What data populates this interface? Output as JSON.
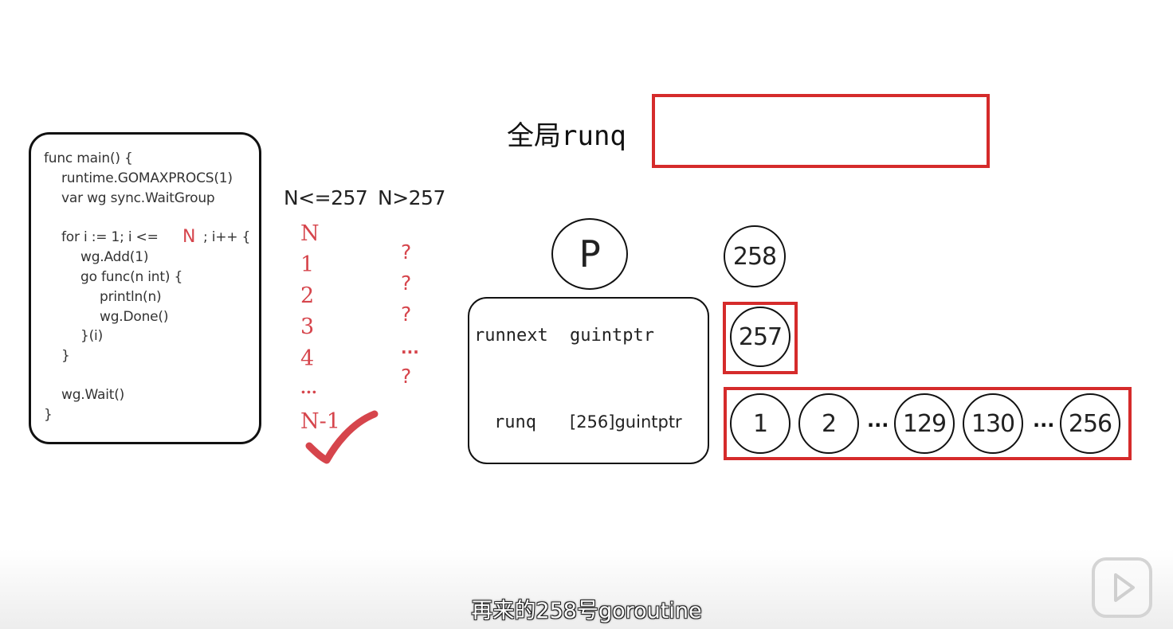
{
  "code": {
    "lines": [
      "func main() {",
      "runtime.GOMAXPROCS(1)",
      "var wg sync.WaitGroup",
      "for i := 1; i <=",
      "N",
      "; i++ {",
      "wg.Add(1)",
      "go func(n int) {",
      "println(n)",
      "wg.Done()",
      "}(i)",
      "}",
      "wg.Wait()",
      "}"
    ]
  },
  "cases": {
    "left_header": "N<=257",
    "right_header": "N>257",
    "left_items": [
      "N",
      "1",
      "2",
      "3",
      "4",
      "...",
      "N-1"
    ],
    "right_items": [
      "?",
      "?",
      "?",
      "...",
      "?"
    ]
  },
  "global": {
    "label": "全局runq"
  },
  "processor": {
    "label": "P",
    "field1_name": "runnext",
    "field1_type": "guintptr",
    "field2_name": "runq",
    "field2_type": "[256]guintptr"
  },
  "goroutines": {
    "incoming": "258",
    "runnext": "257",
    "queue": [
      "1",
      "2",
      "...",
      "129",
      "130",
      "...",
      "256"
    ]
  },
  "subtitle": "再来的258号goroutine",
  "colors": {
    "accent_red": "#d52b2b",
    "text_red": "#d6454c"
  }
}
